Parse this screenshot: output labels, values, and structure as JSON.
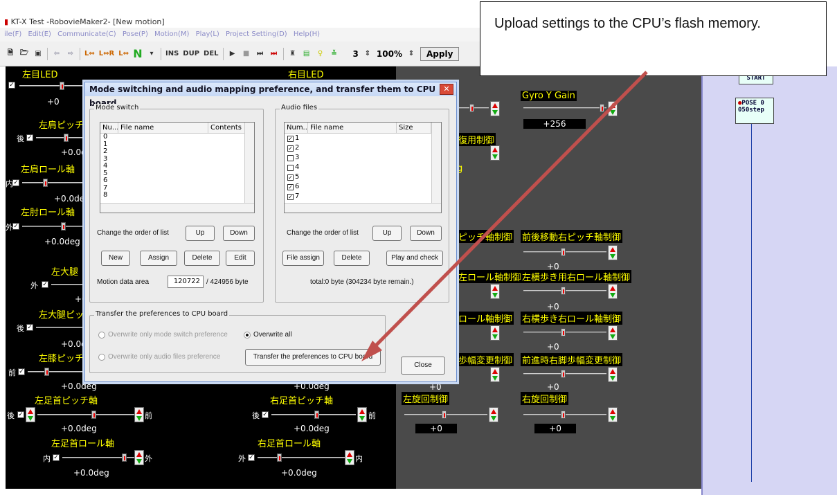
{
  "window": {
    "title": "KT-X Test -RobovieMaker2-  [New motion]",
    "menu": [
      "ile(F)",
      "Edit(E)",
      "Communicate(C)",
      "Pose(P)",
      "Motion(M)",
      "Play(L)",
      "Project Setting(D)",
      "Help(H)"
    ]
  },
  "toolbar": {
    "icons": [
      "new-file-icon",
      "open-folder-icon",
      "save-icon",
      "arrow-left-icon",
      "arrow-right-icon"
    ],
    "btn_l": "L⇔",
    "btn_lr": "L⇔R",
    "btn_l2": "L⇔",
    "ins": "INS",
    "dup": "DUP",
    "del": "DEL",
    "step_value": "3",
    "zoom": "100%",
    "apply": "Apply"
  },
  "callout": {
    "text": "Upload settings to the CPU’s flash memory."
  },
  "joints_left": {
    "l_led": "左目LED",
    "r_led": "右目LED",
    "v0": "+0",
    "l_shoulder_pitch": "左肩ピッチ",
    "back": "後",
    "v_deg1": "+0.0d",
    "l_shoulder_roll": "左肩ロール軸",
    "inner": "内",
    "v_deg2": "+0.0deg",
    "l_elbow_roll": "左肘ロール軸",
    "outer": "外",
    "v_deg3": "+0.0deg",
    "l_thigh": "左大腿",
    "outer2": "外",
    "v_p0": "+0",
    "l_thigh_pitch": "左大腿ピッ",
    "back2": "後",
    "v_deg4": "+0.0d",
    "l_knee": "左膝ピッチ",
    "front": "前",
    "v_deg5": "+0.0deg",
    "v_deg5b": "+0.0deg",
    "l_ankle_pitch": "左足首ピッチ軸",
    "r_ankle_pitch": "右足首ピッチ軸",
    "back3": "後",
    "front2": "前",
    "back4": "後",
    "front3": "前",
    "v_deg6": "+0.0deg",
    "v_deg7": "+0.0deg",
    "l_ankle_roll": "左足首ロール軸",
    "r_ankle_roll": "右足首ロール軸",
    "inner2": "内",
    "outer3": "外",
    "outer4": "外",
    "inner3": "内",
    "v_deg8": "+0.0deg",
    "v_deg9": "+0.0deg"
  },
  "joints_mid": {
    "gyro_y_gain": "Gyro Y Gain",
    "gyro_val": "+256",
    "ctrl1": "復用制御",
    "pitch_ctrl": "ピッチ軸制御",
    "fwd_right_pitch": "前後移動右ピッチ軸制御",
    "v1": "+0",
    "left_roll_ctrl": "左ロール軸制御",
    "side_right_roll": "左横歩き用右ロール軸制御",
    "v2": "+0",
    "roll_ctrl": "ロール軸制御",
    "side_right_roll2": "右横歩き右ロール軸制御",
    "v3": "+0",
    "stride_ctrl": "歩幅変更制御",
    "fwd_right_stride": "前進時右脚歩幅変更制御",
    "v4": "+0",
    "v5": "+0",
    "l_turn": "左旋回制御",
    "r_turn": "右旋回制御",
    "v6": "+0",
    "v7": "+0",
    "g": "g"
  },
  "flow": {
    "start": "START",
    "pose": "POSE 0",
    "step": "050step"
  },
  "dialog": {
    "title": "Mode switching and audio mapping preference, and transfer them to CPU board",
    "mode_switch": {
      "group": "Mode switch",
      "columns": [
        "Nu...",
        "File name",
        "Contents"
      ],
      "rows": [
        "0",
        "1",
        "2",
        "3",
        "4",
        "5",
        "6",
        "7",
        "8"
      ],
      "order_label": "Change the order of list",
      "up": "Up",
      "down": "Down",
      "new": "New",
      "assign": "Assign",
      "delete": "Delete",
      "edit": "Edit",
      "motion_area_label": "Motion data area",
      "motion_area_value": "120722",
      "motion_area_total": "/ 424956 byte"
    },
    "audio": {
      "group": "Audio files",
      "columns": [
        "Num...",
        "File name",
        "Size"
      ],
      "rows": [
        {
          "num": "1",
          "checked": true
        },
        {
          "num": "2",
          "checked": true
        },
        {
          "num": "3",
          "checked": false
        },
        {
          "num": "4",
          "checked": false
        },
        {
          "num": "5",
          "checked": true
        },
        {
          "num": "6",
          "checked": true
        },
        {
          "num": "7",
          "checked": true
        }
      ],
      "order_label": "Change the order of list",
      "up": "Up",
      "down": "Down",
      "file_assign": "File assign",
      "delete": "Delete",
      "play_check": "Play and check",
      "total": "total:0 byte  (304234 byte remain.)"
    },
    "transfer": {
      "group": "Transfer the preferences to CPU board",
      "opt_mode": "Overwrite only mode switch preference",
      "opt_all": "Overwrite all",
      "opt_audio": "Overwrite only audio files preference",
      "transfer_btn": "Transfer the preferences to CPU board",
      "close": "Close"
    }
  },
  "colors": {
    "joint_label": "#ffff00",
    "arrow": "#c0504d",
    "dialog_border": "#6b8fcf"
  }
}
